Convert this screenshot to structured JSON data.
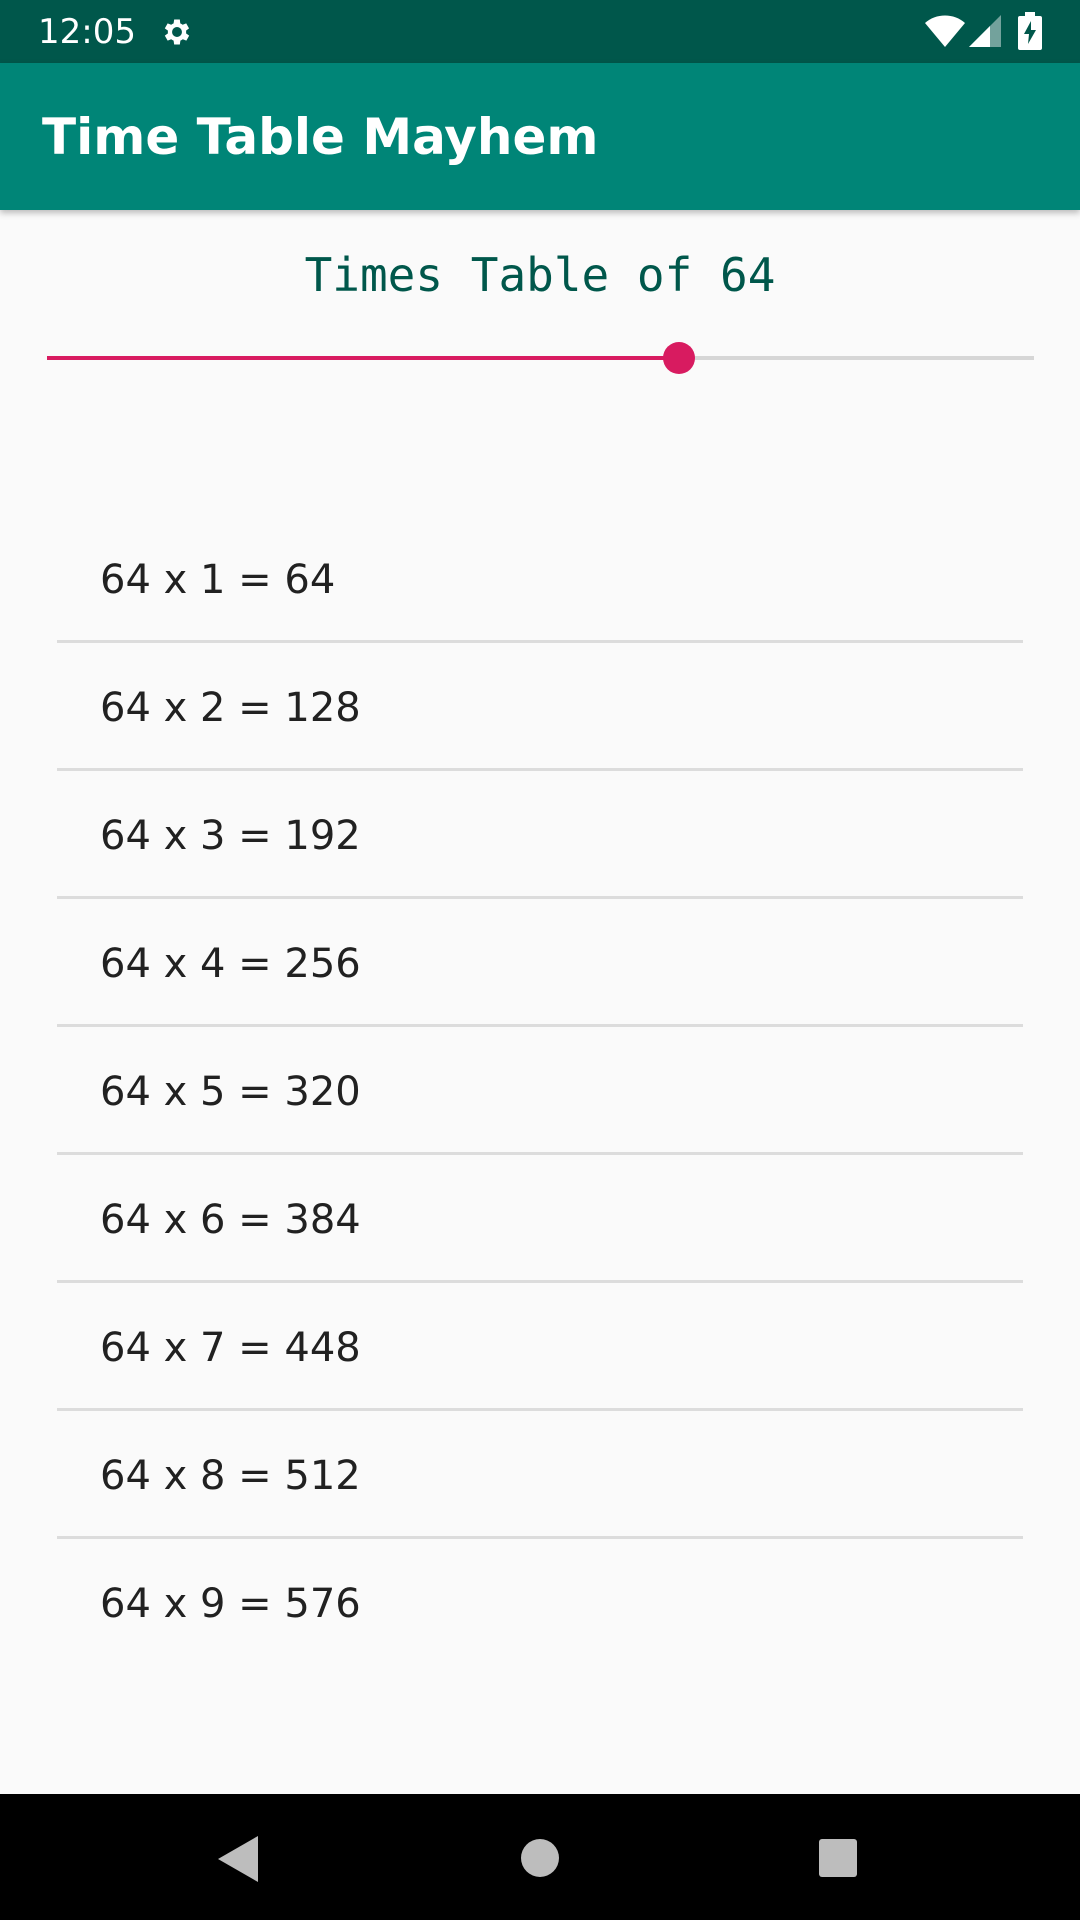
{
  "status_bar": {
    "time": "12:05",
    "icons": [
      "gear-icon",
      "wifi-icon",
      "signal-icon",
      "battery-icon"
    ],
    "background": "#00574b"
  },
  "app_bar": {
    "title": "Time Table Mayhem",
    "background": "#008577"
  },
  "heading": {
    "text": "Times Table of 64",
    "color": "#00574b"
  },
  "slider": {
    "value_fraction": 0.64,
    "accent": "#d81b60"
  },
  "list": {
    "items": [
      "64 x 1 = 64",
      "64 x 2 = 128",
      "64 x 3 = 192",
      "64 x 4 = 256",
      "64 x 5 = 320",
      "64 x 6 = 384",
      "64 x 7 = 448",
      "64 x 8 = 512",
      "64 x 9 = 576"
    ]
  },
  "nav_bar": {
    "icons": [
      "back-icon",
      "home-icon",
      "recents-icon"
    ]
  }
}
